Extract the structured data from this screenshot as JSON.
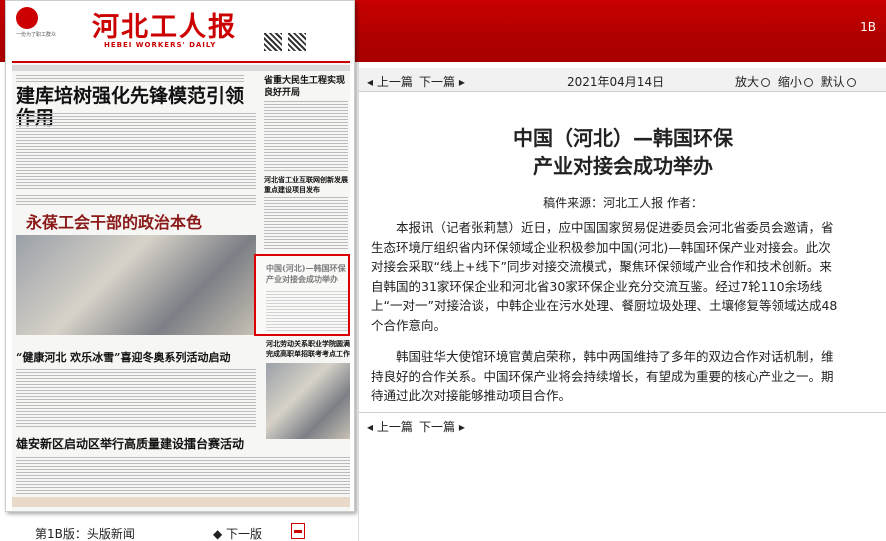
{
  "page_code": "1B",
  "newspaper": {
    "title": "河北工人报",
    "english_name": "HEBEI WORKERS' DAILY",
    "slogan": "一份为了职工群众",
    "headlines": {
      "main": "建库培树强化先锋模范引领作用",
      "side_top": "省重大民生工程实现良好开局",
      "feature": "永葆工会干部的政治本色",
      "boxed": "中国(河北)—韩国环保产业对接会成功举办",
      "mid": "“健康河北 欢乐冰雪”喜迎冬奥系列活动启动",
      "bottom": "雄安新区启动区举行高质量建设擂台赛活动",
      "side_mid": "河北省工业互联网创新发展重点建设项目发布",
      "side_low": "河北劳动关系职业学院圆满完成高职单招联考考点工作"
    }
  },
  "footer": {
    "edition": "第1B版：头版新闻",
    "next": "下一版"
  },
  "nav": {
    "prev": "上一篇",
    "next": "下一篇",
    "date": "2021年04月14日",
    "zoom_in": "放大",
    "zoom_out": "缩小",
    "default": "默认"
  },
  "article": {
    "title_line1": "中国（河北）—韩国环保",
    "title_line2": "产业对接会成功举办",
    "meta": "稿件来源：河北工人报  作者：",
    "paragraphs": [
      "本报讯（记者张莉慧）近日，应中国国家贸易促进委员会河北省委员会邀请，省生态环境厅组织省内环保领域企业积极参加中国(河北)—韩国环保产业对接会。此次对接会采取“线上+线下”同步对接交流模式，聚焦环保领域产业合作和技术创新。来自韩国的31家环保企业和河北省30家环保企业充分交流互鉴。经过7轮110余场线上“一对一”对接洽谈，中韩企业在污水处理、餐厨垃圾处理、土壤修复等领域达成48个合作意向。",
      "韩国驻华大使馆环境官黄启荣称，韩中两国维持了多年的双边合作对话机制，维持良好的合作关系。中国环保产业将会持续增长，有望成为重要的核心产业之一。期待通过此次对接能够推动项目合作。"
    ]
  },
  "colors": {
    "brand_red": "#c00000",
    "highlight_box": "#dd0000"
  }
}
